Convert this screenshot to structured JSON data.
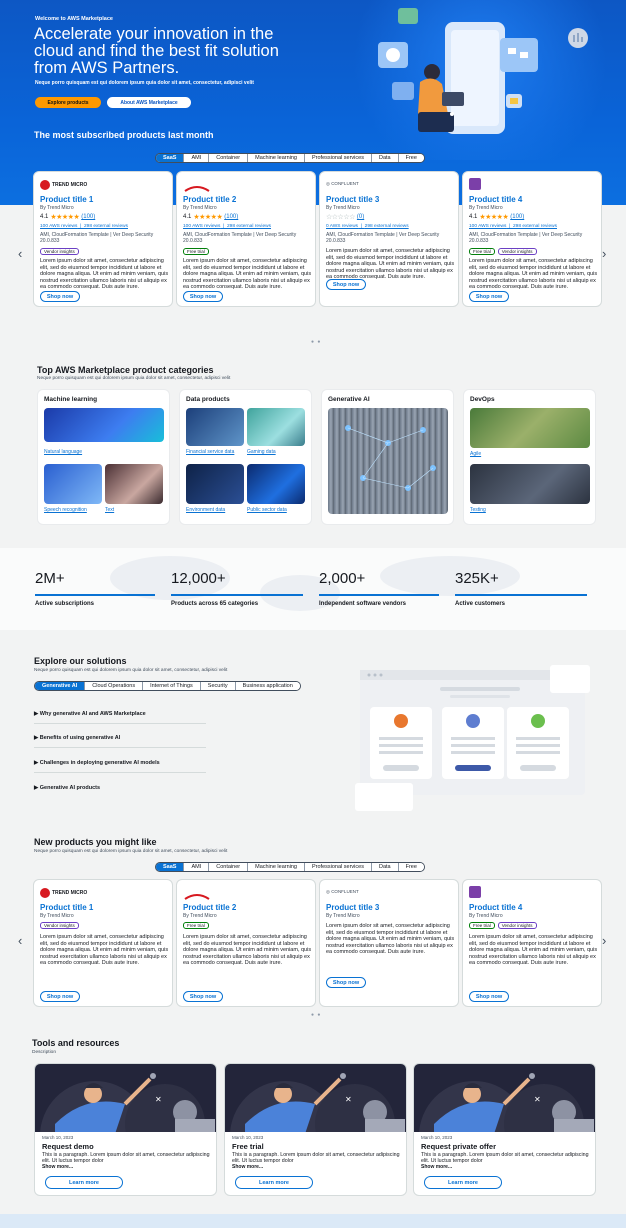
{
  "hero": {
    "welcome": "Welcome to AWS Marketplace",
    "title": "Accelerate your innovation in the cloud and find the best fit solution from AWS Partners.",
    "subtitle": "Neque porro quisquam est qui dolorem ipsum quia dolor sit amet, consectetur, adipisci velit",
    "explore_label": "Explore products",
    "about_label": "About AWS Marketplace"
  },
  "subscribed": {
    "title": "The most subscribed products last month",
    "tabs": [
      "SaaS",
      "AMI",
      "Container",
      "Machine learning",
      "Professional services",
      "Data",
      "Free"
    ],
    "products": [
      {
        "logo": "TREND MICRO",
        "title": "Product title 1",
        "by": "By Trend Micro",
        "rating": "4.1",
        "count": "(100)",
        "reviews": "100 AWS reviews",
        "external": "298 external reviews",
        "meta": "AMI, CloudFormation Template | Ver Deep Security 20.0.833",
        "badges": [
          "Vendor insights"
        ],
        "desc": "Lorem ipsum dolor sit amet, consectetur adipiscing elit, sed do eiusmod tempor incididunt ut labore et dolore magna aliqua. Ut enim ad minim veniam, quis nostrud exercitation ullamco laboris nisi ut aliquip ex ea commodo consequat. Duis aute irure.",
        "shop": "Shop now"
      },
      {
        "logo": "",
        "title": "Product title 2",
        "by": "By Trend Micro",
        "rating": "4.1",
        "count": "(100)",
        "reviews": "100 AWS reviews",
        "external": "298 external reviews",
        "meta": "AMI, CloudFormation Template | Ver Deep Security 20.0.833",
        "badges": [
          "Free trial"
        ],
        "desc": "Lorem ipsum dolor sit amet, consectetur adipiscing elit, sed do eiusmod tempor incididunt ut labore et dolore magna aliqua. Ut enim ad minim veniam, quis nostrud exercitation ullamco laboris nisi ut aliquip ex ea commodo consequat. Duis aute irure.",
        "shop": "Shop now"
      },
      {
        "logo": "CONFLUENT",
        "title": "Product title 3",
        "by": "By Trend Micro",
        "rating": "",
        "count": "(0)",
        "reviews": "0 AWS reviews",
        "external": "298 external reviews",
        "meta": "AMI, CloudFormation Template | Ver Deep Security 20.0.833",
        "badges": [],
        "desc": "Lorem ipsum dolor sit amet, consectetur adipiscing elit, sed do eiusmod tempor incididunt ut labore et dolore magna aliqua. Ut enim ad minim veniam, quis nostrud exercitation ullamco laboris nisi ut aliquip ex ea commodo consequat. Duis aute irure.",
        "shop": "Shop now"
      },
      {
        "logo": "",
        "title": "Product title 4",
        "by": "By Trend Micro",
        "rating": "4.1",
        "count": "(100)",
        "reviews": "100 AWS reviews",
        "external": "298 external reviews",
        "meta": "AMI, CloudFormation Template | Ver Deep Security 20.0.833",
        "badges": [
          "Free trial",
          "Vendor insights"
        ],
        "desc": "Lorem ipsum dolor sit amet, consectetur adipiscing elit, sed do eiusmod tempor incididunt ut labore et dolore magna aliqua. Ut enim ad minim veniam, quis nostrud exercitation ullamco laboris nisi ut aliquip ex ea commodo consequat. Duis aute irure.",
        "shop": "Shop now"
      }
    ]
  },
  "categories": {
    "title": "Top AWS Marketplace product categories",
    "desc": "Neque porro quisquam est qui dolorem ipsum quia dolor sit amet, consectetur, adipisci velit",
    "panels": [
      {
        "title": "Machine learning",
        "links": [
          "Natural language",
          "Speech recognition",
          "Text"
        ]
      },
      {
        "title": "Data products",
        "links": [
          "Financial service data",
          "Gaming data",
          "Environment data",
          "Public sector data"
        ]
      },
      {
        "title": "Generative AI",
        "links": []
      },
      {
        "title": "DevOps",
        "links": [
          "Agile",
          "Testing"
        ]
      }
    ]
  },
  "stats": [
    {
      "num": "2M+",
      "label": "Active subscriptions"
    },
    {
      "num": "12,000+",
      "label": "Products across 65 categories"
    },
    {
      "num": "2,000+",
      "label": "Independent software vendors"
    },
    {
      "num": "325K+",
      "label": "Active customers"
    }
  ],
  "solutions": {
    "title": "Explore our solutions",
    "desc": "Neque porro quisquam est qui dolorem ipsum quia dolor sit amet, consectetur, adipisci velit",
    "tabs": [
      "Generative AI",
      "Cloud Operations",
      "Internet of Things",
      "Security",
      "Business application"
    ],
    "items": [
      "Why generative AI and AWS Marketplace",
      "Benefits of using generative AI",
      "Challenges in deploying generative AI models",
      "Generative AI products"
    ]
  },
  "new_products": {
    "title": "New products you might like",
    "desc": "Neque porro quisquam est qui dolorem ipsum quia dolor sit amet, consectetur, adipisci velit",
    "tabs": [
      "SaaS",
      "AMI",
      "Container",
      "Machine learning",
      "Professional services",
      "Data",
      "Free"
    ],
    "products": [
      {
        "title": "Product title 1",
        "by": "By Trend Micro",
        "badges": [
          "Vendor insights"
        ],
        "desc": "Lorem ipsum dolor sit amet, consectetur adipiscing elit, sed do eiusmod tempor incididunt ut labore et dolore magna aliqua. Ut enim ad minim veniam, quis nostrud exercitation ullamco laboris nisi ut aliquip ex ea commodo consequat. Duis aute irure.",
        "shop": "Shop now"
      },
      {
        "title": "Product title 2",
        "by": "By Trend Micro",
        "badges": [
          "Free trial"
        ],
        "desc": "Lorem ipsum dolor sit amet, consectetur adipiscing elit, sed do eiusmod tempor incididunt ut labore et dolore magna aliqua. Ut enim ad minim veniam, quis nostrud exercitation ullamco laboris nisi ut aliquip ex ea commodo consequat. Duis aute irure.",
        "shop": "Shop now"
      },
      {
        "title": "Product title 3",
        "by": "By Trend Micro",
        "badges": [],
        "desc": "Lorem ipsum dolor sit amet, consectetur adipiscing elit, sed do eiusmod tempor incididunt ut labore et dolore magna aliqua. Ut enim ad minim veniam, quis nostrud exercitation ullamco laboris nisi ut aliquip ex ea commodo consequat. Duis aute irure.",
        "shop": "Shop now"
      },
      {
        "title": "Product title 4",
        "by": "By Trend Micro",
        "badges": [
          "Free trial",
          "Vendor insights"
        ],
        "desc": "Lorem ipsum dolor sit amet, consectetur adipiscing elit, sed do eiusmod tempor incididunt ut labore et dolore magna aliqua. Ut enim ad minim veniam, quis nostrud exercitation ullamco laboris nisi ut aliquip ex ea commodo consequat. Duis aute irure.",
        "shop": "Shop now"
      }
    ]
  },
  "tools": {
    "title": "Tools and resources",
    "desc": "Description",
    "cards": [
      {
        "date": "March 10, 2023",
        "title": "Request demo",
        "text": "This is a paragraph. Lorem ipsum dolor sit amet, consectetur adipiscing elit. Ut luctus tempor dolor",
        "more": "Show more...",
        "button": "Learn more"
      },
      {
        "date": "March 10, 2023",
        "title": "Free trial",
        "text": "This is a paragraph. Lorem ipsum dolor sit amet, consectetur adipiscing elit. Ut luctus tempor dolor",
        "more": "Show more...",
        "button": "Learn more"
      },
      {
        "date": "March 10, 2023",
        "title": "Request private offer",
        "text": "This is a paragraph. Lorem ipsum dolor sit amet, consectetur adipiscing elit. Ut luctus tempor dolor",
        "more": "Show more...",
        "button": "Learn more"
      }
    ]
  },
  "colors": {
    "primary": "#0972d3",
    "hero": "#0a5fd6",
    "accent": "#ff9900",
    "star": "#ff9900"
  },
  "icons": [
    "chevron-left-icon",
    "chevron-right-icon",
    "star-icon",
    "caret-right-icon"
  ]
}
